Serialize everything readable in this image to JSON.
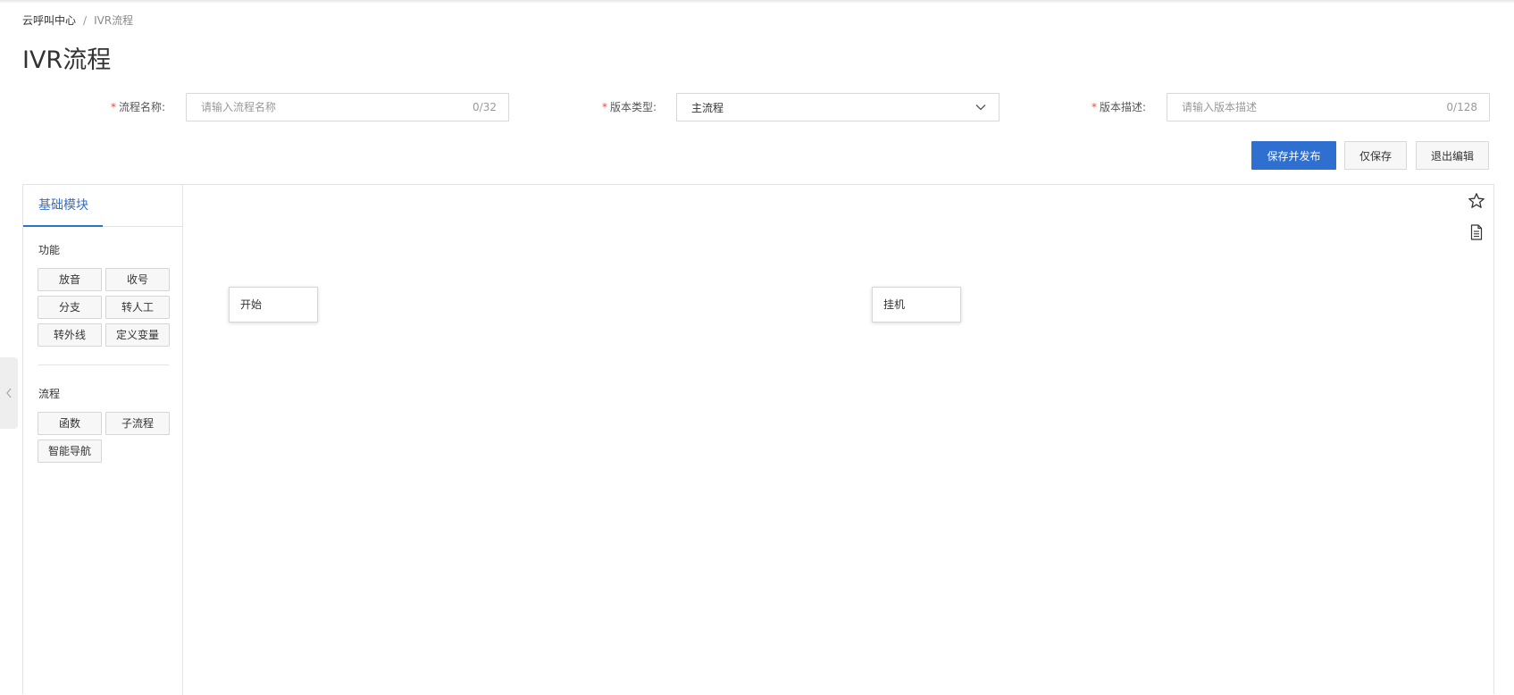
{
  "breadcrumb": {
    "root": "云呼叫中心",
    "separator": "/",
    "current": "IVR流程"
  },
  "page": {
    "title": "IVR流程"
  },
  "form": {
    "flow_name": {
      "label": "流程名称:",
      "placeholder": "请输入流程名称",
      "value": "",
      "counter": "0/32"
    },
    "version_type": {
      "label": "版本类型:",
      "value": "主流程"
    },
    "version_desc": {
      "label": "版本描述:",
      "placeholder": "请输入版本描述",
      "value": "",
      "counter": "0/128"
    },
    "required_mark": "*"
  },
  "actions": {
    "save_publish": "保存并发布",
    "save_only": "仅保存",
    "exit_edit": "退出编辑"
  },
  "palette": {
    "tab": "基础模块",
    "groups": [
      {
        "title": "功能",
        "items": [
          "放音",
          "收号",
          "分支",
          "转人工",
          "转外线",
          "定义变量"
        ]
      },
      {
        "title": "流程",
        "items": [
          "函数",
          "子流程",
          "智能导航"
        ]
      }
    ]
  },
  "canvas": {
    "nodes": [
      {
        "label": "开始"
      },
      {
        "label": "挂机"
      }
    ],
    "tools": [
      "star-icon",
      "document-icon"
    ]
  },
  "colors": {
    "primary": "#2e6fcf",
    "required": "#e04f3e",
    "border": "#d8d8d8"
  }
}
